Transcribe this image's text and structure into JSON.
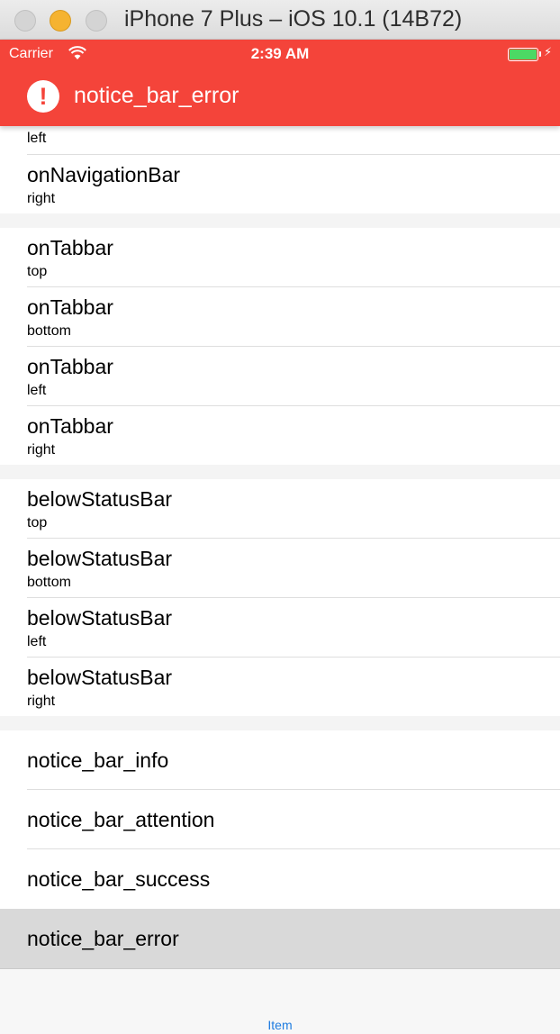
{
  "window": {
    "title": "iPhone 7 Plus – iOS 10.1 (14B72)"
  },
  "status_bar": {
    "carrier": "Carrier",
    "time": "2:39 AM",
    "battery_level": 1.0
  },
  "notice": {
    "icon": "exclamation-circle-icon",
    "icon_glyph": "!",
    "title": "notice_bar_error",
    "color": "#f4443a"
  },
  "table": {
    "clipped_top_subtitle": "left",
    "sections": [
      {
        "rows": [
          {
            "title": "onNavigationBar",
            "subtitle": "right"
          }
        ]
      },
      {
        "rows": [
          {
            "title": "onTabbar",
            "subtitle": "top"
          },
          {
            "title": "onTabbar",
            "subtitle": "bottom"
          },
          {
            "title": "onTabbar",
            "subtitle": "left"
          },
          {
            "title": "onTabbar",
            "subtitle": "right"
          }
        ]
      },
      {
        "rows": [
          {
            "title": "belowStatusBar",
            "subtitle": "top"
          },
          {
            "title": "belowStatusBar",
            "subtitle": "bottom"
          },
          {
            "title": "belowStatusBar",
            "subtitle": "left"
          },
          {
            "title": "belowStatusBar",
            "subtitle": "right"
          }
        ]
      },
      {
        "rows": [
          {
            "title": "notice_bar_info"
          },
          {
            "title": "notice_bar_attention"
          },
          {
            "title": "notice_bar_success"
          },
          {
            "title": "notice_bar_error",
            "selected": true
          }
        ]
      }
    ]
  },
  "tab_bar": {
    "item_label": "Item",
    "tint": "#1f7ce0"
  }
}
